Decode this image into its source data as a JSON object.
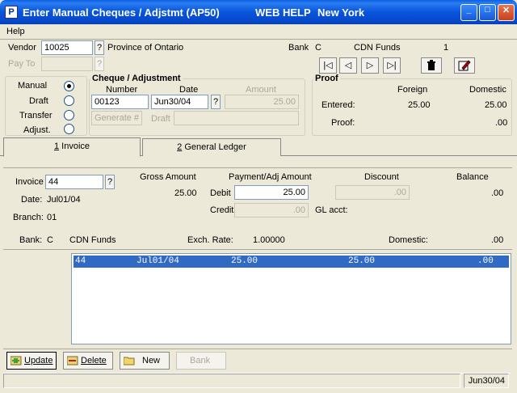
{
  "window": {
    "title": "Enter Manual Cheques / Adjstmt (AP50)",
    "title_help": "WEB HELP",
    "title_city": "New York",
    "app_icon_letter": "P",
    "minimize_glyph": "_",
    "maximize_glyph": "□",
    "close_glyph": "✕"
  },
  "menu": {
    "help": "Help"
  },
  "header": {
    "vendor_label": "Vendor",
    "vendor_value": "10025",
    "vendor_name": "Province of Ontario",
    "payto_label": "Pay To",
    "lookup_glyph": "?",
    "bank_label": "Bank",
    "bank_code": "C",
    "bank_name": "CDN Funds",
    "bank_number": "1"
  },
  "nav": {
    "first": "|◁",
    "prev": "◁",
    "next": "▷",
    "last": "▷|",
    "delete_icon": "trash-icon",
    "edit_icon": "edit-icon"
  },
  "type_options": {
    "items": [
      {
        "label": "Manual",
        "selected": true
      },
      {
        "label": "Draft",
        "selected": false
      },
      {
        "label": "Transfer",
        "selected": false
      },
      {
        "label": "Adjust.",
        "selected": false
      }
    ]
  },
  "cheque": {
    "title": "Cheque / Adjustment",
    "number_label": "Number",
    "date_label": "Date",
    "amount_label": "Amount",
    "number_value": "00123",
    "date_value": "Jun30/04",
    "amount_value": "25.00",
    "generate_label": "Generate #",
    "draft_label": "Draft"
  },
  "proof": {
    "title": "Proof",
    "foreign_label": "Foreign",
    "domestic_label": "Domestic",
    "entered_label": "Entered:",
    "entered_foreign": "25.00",
    "entered_domestic": "25.00",
    "proof_label": "Proof:",
    "proof_domestic": ".00"
  },
  "tabs": [
    {
      "num": "1",
      "label": "Invoice"
    },
    {
      "num": "2",
      "label": "General Ledger"
    }
  ],
  "invoice": {
    "invoice_label": "Invoice",
    "invoice_value": "44",
    "date_label": "Date:",
    "date_value": "Jul01/04",
    "branch_label": "Branch:",
    "branch_value": "01",
    "gross_label": "Gross Amount",
    "gross_value": "25.00",
    "payment_label": "Payment/Adj Amount",
    "debit_label": "Debit",
    "debit_value": "25.00",
    "credit_label": "Credit",
    "credit_value": ".00",
    "discount_label": "Discount",
    "discount_value": ".00",
    "gl_acct_label": "GL acct:",
    "balance_label": "Balance",
    "balance_value": ".00",
    "bank_label": "Bank:",
    "bank_code": "C",
    "bank_name": "CDN Funds",
    "exch_label": "Exch. Rate:",
    "exch_value": "1.00000",
    "domestic_label": "Domestic:",
    "domestic_value": ".00"
  },
  "list": {
    "rows": [
      {
        "invoice": "44",
        "date": "Jul01/04",
        "gross": "25.00",
        "payment": "25.00",
        "balance": ".00"
      }
    ]
  },
  "toolbar": {
    "update": "Update",
    "delete": "Delete",
    "new": "New",
    "bank": "Bank"
  },
  "status": {
    "date": "Jun30/04"
  },
  "colors": {
    "titlebar": "#0855DD",
    "selection": "#316AC5",
    "window_bg": "#ECE9D8"
  }
}
